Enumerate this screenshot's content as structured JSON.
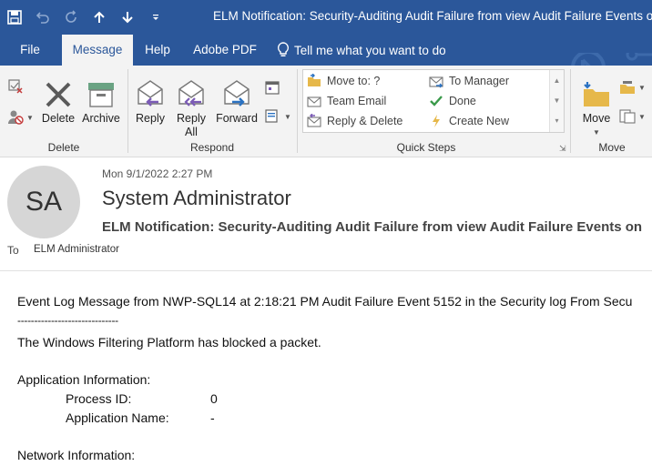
{
  "window": {
    "title": "ELM Notification: Security-Auditing Audit Failure from view Audit Failure Events on"
  },
  "qat": {
    "icons": [
      "save-icon",
      "undo-icon",
      "redo-icon",
      "up-arrow-icon",
      "down-arrow-icon",
      "customize-icon"
    ]
  },
  "tabs": [
    {
      "label": "File"
    },
    {
      "label": "Message"
    },
    {
      "label": "Help"
    },
    {
      "label": "Adobe PDF"
    }
  ],
  "tellme": {
    "label": "Tell me what you want to do"
  },
  "ribbon": {
    "delete_group": {
      "label": "Delete",
      "delete_label": "Delete",
      "archive_label": "Archive"
    },
    "respond_group": {
      "label": "Respond",
      "reply_label": "Reply",
      "reply_all_label_1": "Reply",
      "reply_all_label_2": "All",
      "forward_label": "Forward"
    },
    "quick_steps": {
      "label": "Quick Steps",
      "items": [
        "Move to: ?",
        "Team Email",
        "Reply & Delete",
        "To Manager",
        "Done",
        "Create New"
      ]
    },
    "move_group": {
      "label": "Move",
      "move_label": "Move"
    }
  },
  "message": {
    "avatar_initials": "SA",
    "datetime": "Mon 9/1/2022 2:27 PM",
    "sender": "System Administrator",
    "subject": "ELM Notification: Security-Auditing Audit Failure from view Audit Failure Events on",
    "to_label": "To",
    "to": "ELM Administrator"
  },
  "body": {
    "line1": "Event Log Message from NWP-SQL14 at 2:18:21 PM Audit Failure Event 5152 in the Security log From Secu",
    "separator": "------------------------------",
    "line2": "The Windows Filtering Platform has blocked a packet.",
    "app_info_heading": "Application Information:",
    "process_id_label": "Process ID:",
    "process_id_value": "0",
    "app_name_label": "Application Name:",
    "app_name_value": "-",
    "net_info_heading": "Network Information:"
  },
  "colors": {
    "titlebar": "#2b579a",
    "ribbon": "#f3f3f3",
    "accent_purple": "#7b5bb6",
    "accent_blue": "#2b72c2"
  }
}
